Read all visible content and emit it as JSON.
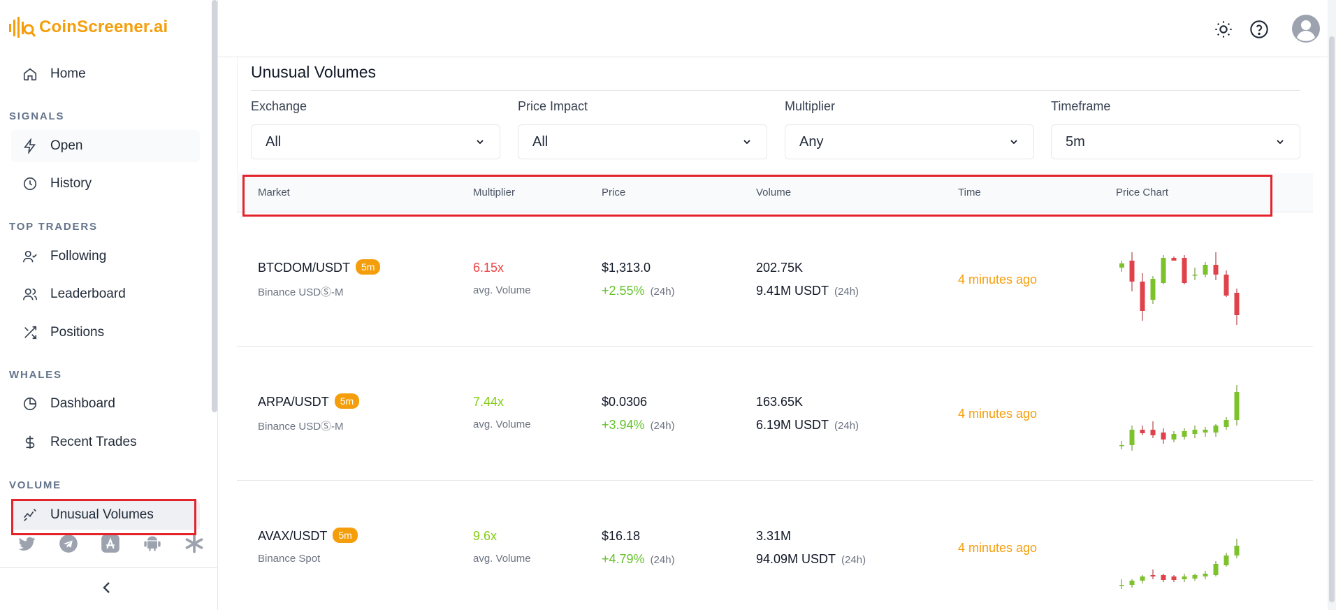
{
  "brand": {
    "name": "CoinScreener.ai",
    "color": "#f59e0b"
  },
  "sidebar": {
    "home": {
      "label": "Home",
      "icon": "home-icon"
    },
    "sections": {
      "signals": "SIGNALS",
      "top_traders": "TOP TRADERS",
      "whales": "WHALES",
      "volume": "VOLUME"
    },
    "signals": [
      {
        "label": "Open",
        "icon": "lightning-icon"
      },
      {
        "label": "History",
        "icon": "clock-icon"
      }
    ],
    "top_traders": [
      {
        "label": "Following",
        "icon": "user-check-icon"
      },
      {
        "label": "Leaderboard",
        "icon": "users-icon"
      },
      {
        "label": "Positions",
        "icon": "shuffle-icon"
      }
    ],
    "whales": [
      {
        "label": "Dashboard",
        "icon": "pie-chart-icon"
      },
      {
        "label": "Recent Trades",
        "icon": "dollar-icon"
      }
    ],
    "volume": [
      {
        "label": "Unusual Volumes",
        "icon": "activity-icon"
      }
    ],
    "social": [
      "twitter-icon",
      "telegram-icon",
      "app-store-icon",
      "android-icon",
      "asterisk-icon"
    ]
  },
  "topbar": {
    "icons": [
      "sun-icon",
      "help-icon",
      "user-avatar-icon"
    ]
  },
  "page": {
    "title": "Unusual Volumes"
  },
  "filters": [
    {
      "label": "Exchange",
      "value": "All"
    },
    {
      "label": "Price Impact",
      "value": "All"
    },
    {
      "label": "Multiplier",
      "value": "Any"
    },
    {
      "label": "Timeframe",
      "value": "5m"
    }
  ],
  "table": {
    "columns": [
      "Market",
      "Multiplier",
      "Price",
      "Volume",
      "Time",
      "Price Chart"
    ],
    "rows": [
      {
        "market": "BTCDOM/USDT",
        "badge": "5m",
        "exchange": "Binance USDⓈ-M",
        "multiplier": "6.15x",
        "multiplier_color": "#ef4444",
        "multiplier_sub": "avg. Volume",
        "price": "$1,313.0",
        "change": "+2.55%",
        "change_period": "(24h)",
        "volume": "202.75K",
        "volume_24h": "9.41M USDT",
        "volume_period": "(24h)",
        "time": "4 minutes ago"
      },
      {
        "market": "ARPA/USDT",
        "badge": "5m",
        "exchange": "Binance USDⓈ-M",
        "multiplier": "7.44x",
        "multiplier_color": "#84cc16",
        "multiplier_sub": "avg. Volume",
        "price": "$0.0306",
        "change": "+3.94%",
        "change_period": "(24h)",
        "volume": "163.65K",
        "volume_24h": "6.19M USDT",
        "volume_period": "(24h)",
        "time": "4 minutes ago"
      },
      {
        "market": "AVAX/USDT",
        "badge": "5m",
        "exchange": "Binance Spot",
        "multiplier": "9.6x",
        "multiplier_color": "#84cc16",
        "multiplier_sub": "avg. Volume",
        "price": "$16.18",
        "change": "+4.79%",
        "change_period": "(24h)",
        "volume": "3.31M",
        "volume_24h": "94.09M USDT",
        "volume_period": "(24h)",
        "time": "4 minutes ago"
      }
    ]
  },
  "colors": {
    "up": "#7cc22b",
    "down": "#e0424b",
    "accent": "#f59e0b",
    "highlight": "#e3242b"
  }
}
